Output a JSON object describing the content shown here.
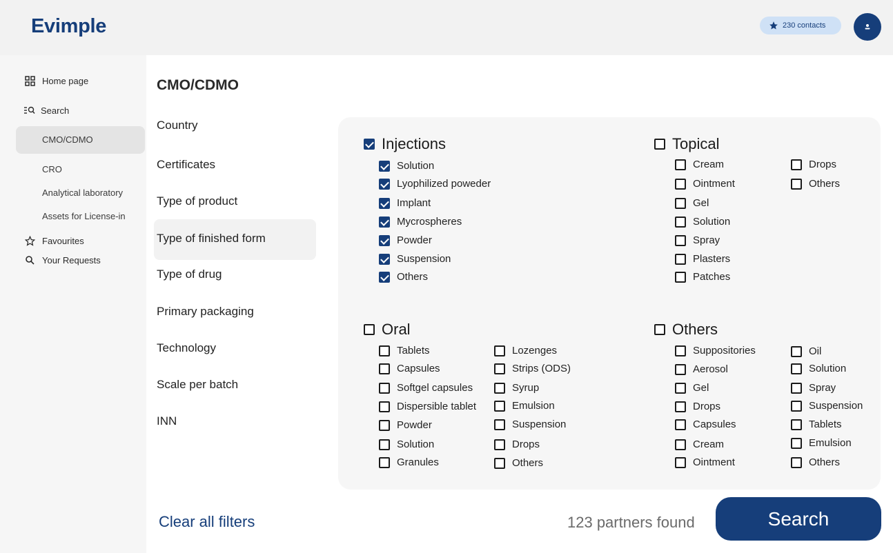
{
  "app": {
    "logo": "Evimple"
  },
  "header": {
    "contacts_label": "230 contacts"
  },
  "sidebar": {
    "home": "Home page",
    "search": "Search",
    "search_items": [
      "CMO/CDMO",
      "CRO",
      "Analytical laboratory",
      "Assets for License-in"
    ],
    "active_item": "CMO/CDMO",
    "favourites": "Favourites",
    "requests": "Your Requests"
  },
  "main": {
    "title": "CMO/CDMO",
    "categories": [
      "Country",
      "Certificates",
      "Type of product",
      "Type of finished form",
      "Type of drug",
      "Primary packaging",
      "Technology",
      "Scale per batch",
      "INN"
    ],
    "active_category": "Type of finished form"
  },
  "filters": {
    "injections": {
      "label": "Injections",
      "checked": true,
      "options": [
        {
          "label": "Solution",
          "checked": true
        },
        {
          "label": "Lyophilized poweder",
          "checked": true
        },
        {
          "label": "Implant",
          "checked": true
        },
        {
          "label": "Mycrospheres",
          "checked": true
        },
        {
          "label": "Powder",
          "checked": true
        },
        {
          "label": "Suspension",
          "checked": true
        },
        {
          "label": "Others",
          "checked": true
        }
      ]
    },
    "topical": {
      "label": "Topical",
      "checked": false,
      "options": [
        "Cream",
        "Ointment",
        "Gel",
        "Solution",
        "Spray",
        "Plasters",
        "Patches",
        "Drops",
        "Others"
      ]
    },
    "oral": {
      "label": "Oral",
      "checked": false,
      "options": [
        "Tablets",
        "Capsules",
        "Softgel capsules",
        "Dispersible tablet",
        "Powder",
        "Solution",
        "Granules",
        "Lozenges",
        "Strips (ODS)",
        "Syrup",
        "Emulsion",
        "Suspension",
        "Drops",
        "Others"
      ]
    },
    "others": {
      "label": "Others",
      "checked": false,
      "options": [
        "Suppositories",
        "Aerosol",
        "Gel",
        "Drops",
        "Capsules",
        "Cream",
        "Ointment",
        "Oil",
        "Solution",
        "Spray",
        "Suspension",
        "Tablets",
        "Emulsion",
        "Others"
      ]
    }
  },
  "footer": {
    "clear_label": "Clear all filters",
    "found_label": "123 partners found",
    "search_label": "Search"
  },
  "colors": {
    "brand": "#163e7a",
    "badge": "#cfe1f6"
  }
}
